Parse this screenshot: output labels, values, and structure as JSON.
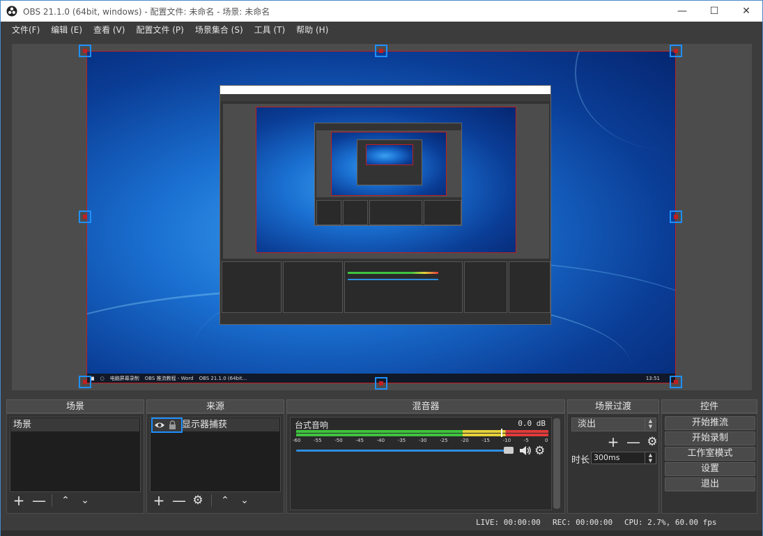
{
  "window": {
    "title": "OBS 21.1.0 (64bit, windows) - 配置文件: 未命名 - 场景: 未命名",
    "minimize_icon": "minimize-icon",
    "maximize_icon": "maximize-icon",
    "close_icon": "close-icon"
  },
  "menu": [
    "文件(F)",
    "编辑 (E)",
    "查看 (V)",
    "配置文件 (P)",
    "场景集合 (S)",
    "工具 (T)",
    "帮助 (H)"
  ],
  "docks": {
    "scenes": {
      "header": "场景",
      "items": [
        "场景"
      ]
    },
    "sources": {
      "header": "来源",
      "items": [
        "显示器捕获"
      ]
    },
    "mixer": {
      "header": "混音器",
      "channel_name": "台式音响",
      "level": "0.0 dB",
      "scale": [
        "-60",
        "-55",
        "-50",
        "-45",
        "-40",
        "-35",
        "-30",
        "-25",
        "-20",
        "-15",
        "-10",
        "-5",
        "0"
      ],
      "volume_fraction": 1.0
    },
    "transitions": {
      "header": "场景过渡",
      "selected": "淡出",
      "duration_label": "时长",
      "duration_value": "300ms"
    },
    "controls": {
      "header": "控件",
      "buttons": [
        "开始推流",
        "开始录制",
        "工作室模式",
        "设置",
        "退出"
      ]
    }
  },
  "status": {
    "live": "LIVE: 00:00:00",
    "rec": "REC: 00:00:00",
    "cpu": "CPU: 2.7%, 60.00 fps"
  },
  "taskbar": {
    "items": [
      "电脑屏幕录制",
      "OBS 推流教程 - Word",
      "OBS 21.1.0 (64bit..."
    ],
    "time": "13:51"
  },
  "colors": {
    "accent": "#1e90ff",
    "selection_red": "#c02020",
    "meter_green": "#3fc43f",
    "meter_yellow": "#e6d23a",
    "meter_red": "#e03a3a",
    "volume_blue": "#2f8fe0"
  }
}
